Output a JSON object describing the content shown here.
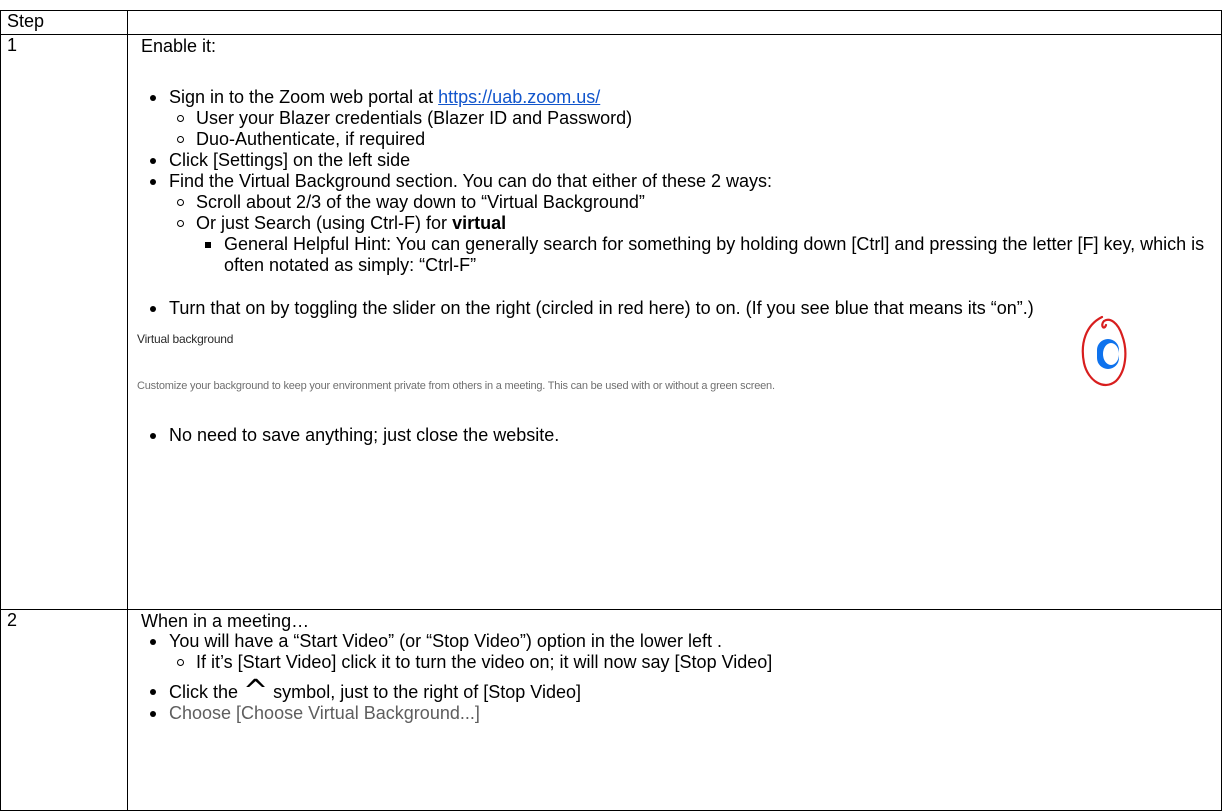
{
  "table": {
    "header": {
      "step_label": "Step",
      "content_label": ""
    },
    "rows": [
      {
        "step": "1",
        "intro": "Enable it:",
        "bullets": [
          {
            "text_prefix": "Sign in to the Zoom web portal at ",
            "link": "https://uab.zoom.us/",
            "sub": [
              "User your Blazer credentials (Blazer ID and Password)",
              "Duo-Authenticate, if required"
            ]
          },
          {
            "text": "Click [Settings] on the left side"
          },
          {
            "text": "Find the Virtual Background section.  You can do that either of these 2 ways:",
            "sub_a": "Scroll about 2/3 of the way down to “Virtual Background”",
            "sub_b_prefix": "Or just Search (using Ctrl-F) for ",
            "sub_b_bold": "virtual",
            "sub_b_sub": "General Helpful Hint: You can generally search for something by holding down [Ctrl] and pressing the letter [F] key, which is often notated as simply: “Ctrl-F”"
          },
          {
            "text": "Turn that on by toggling the slider on the right (circled in red here) to on.  (If you see blue that means its “on”.)"
          }
        ],
        "screenshot": {
          "title": "Virtual background",
          "description": "Customize your background to keep your environment private from others in a meeting. This can be used with or without a green screen."
        },
        "final_bullet": "No need to save anything; just close the website."
      },
      {
        "step": "2",
        "intro": "When in a meeting…",
        "bullet_a": "You will have a “Start Video” (or “Stop Video”)  option in the lower left .",
        "bullet_a_sub": "If it’s [Start Video] click it to turn the video on; it will now say [Stop Video]",
        "bullet_b_prefix": "Click the ",
        "bullet_b_symbol": "^",
        "bullet_b_suffix": " symbol, just to the right of [Stop Video]",
        "bullet_c": "Choose [Choose Virtual Background...]"
      }
    ]
  },
  "colors": {
    "link": "#1155cc",
    "toggle_blue": "#0e72ed",
    "circle_red": "#d81e1e"
  }
}
